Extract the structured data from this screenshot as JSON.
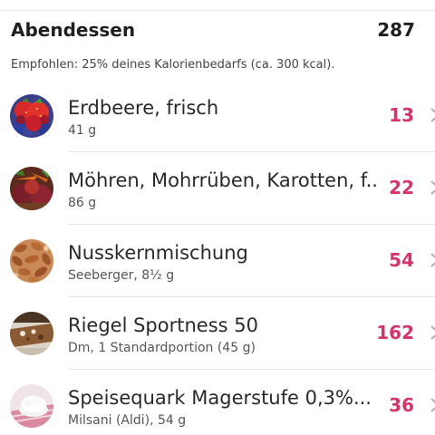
{
  "meal": {
    "title": "Abendessen",
    "total": "287",
    "recommendation": "Empfohlen: 25% deines Kalorienbedarfs (ca. 300 kcal)."
  },
  "items": [
    {
      "name": "Erdbeere, frisch",
      "detail": "41 g",
      "kcal": "13",
      "icon": "berries-icon"
    },
    {
      "name": "Möhren, Mohrrüben, Karotten, f...",
      "detail": "86 g",
      "kcal": "22",
      "icon": "vegetables-icon"
    },
    {
      "name": "Nusskernmischung",
      "detail": "Seeberger, 8½ g",
      "kcal": "54",
      "icon": "nuts-icon"
    },
    {
      "name": "Riegel Sportness 50",
      "detail": "Dm, 1 Standardportion (45 g)",
      "kcal": "162",
      "icon": "bar-icon"
    },
    {
      "name": "Speisequark  Magerstufe  0,3%...",
      "detail": "Milsani (Aldi), 54 g",
      "kcal": "36",
      "icon": "quark-icon"
    }
  ],
  "colors": {
    "kcal": "#d6336c",
    "divider": "#e6e6e6",
    "text": "#1f1f1f"
  }
}
